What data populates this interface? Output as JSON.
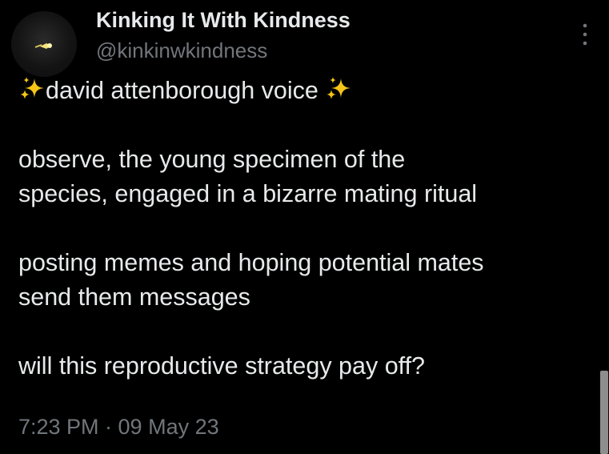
{
  "tweet": {
    "author": {
      "display_name": "Kinking It With Kindness",
      "handle": "@kinkinwkindness",
      "avatar_icon": "avatar-sparkle-icon"
    },
    "lines": {
      "l1": "david attenborough voice",
      "l2": "observe, the young specimen of the",
      "l3": "species, engaged in a bizarre mating ritual",
      "l4": "posting memes and hoping potential mates",
      "l5": "send them messages",
      "l6": "will this reproductive strategy pay off?"
    },
    "timestamp": "7:23 PM · 09 May 23",
    "more_icon": "more-vertical-icon",
    "sparkle_icon": "sparkles-icon"
  },
  "colors": {
    "background": "#000000",
    "text_primary": "#e7e9ea",
    "text_secondary": "#71767b",
    "sparkle_gold": "#f5c518"
  }
}
